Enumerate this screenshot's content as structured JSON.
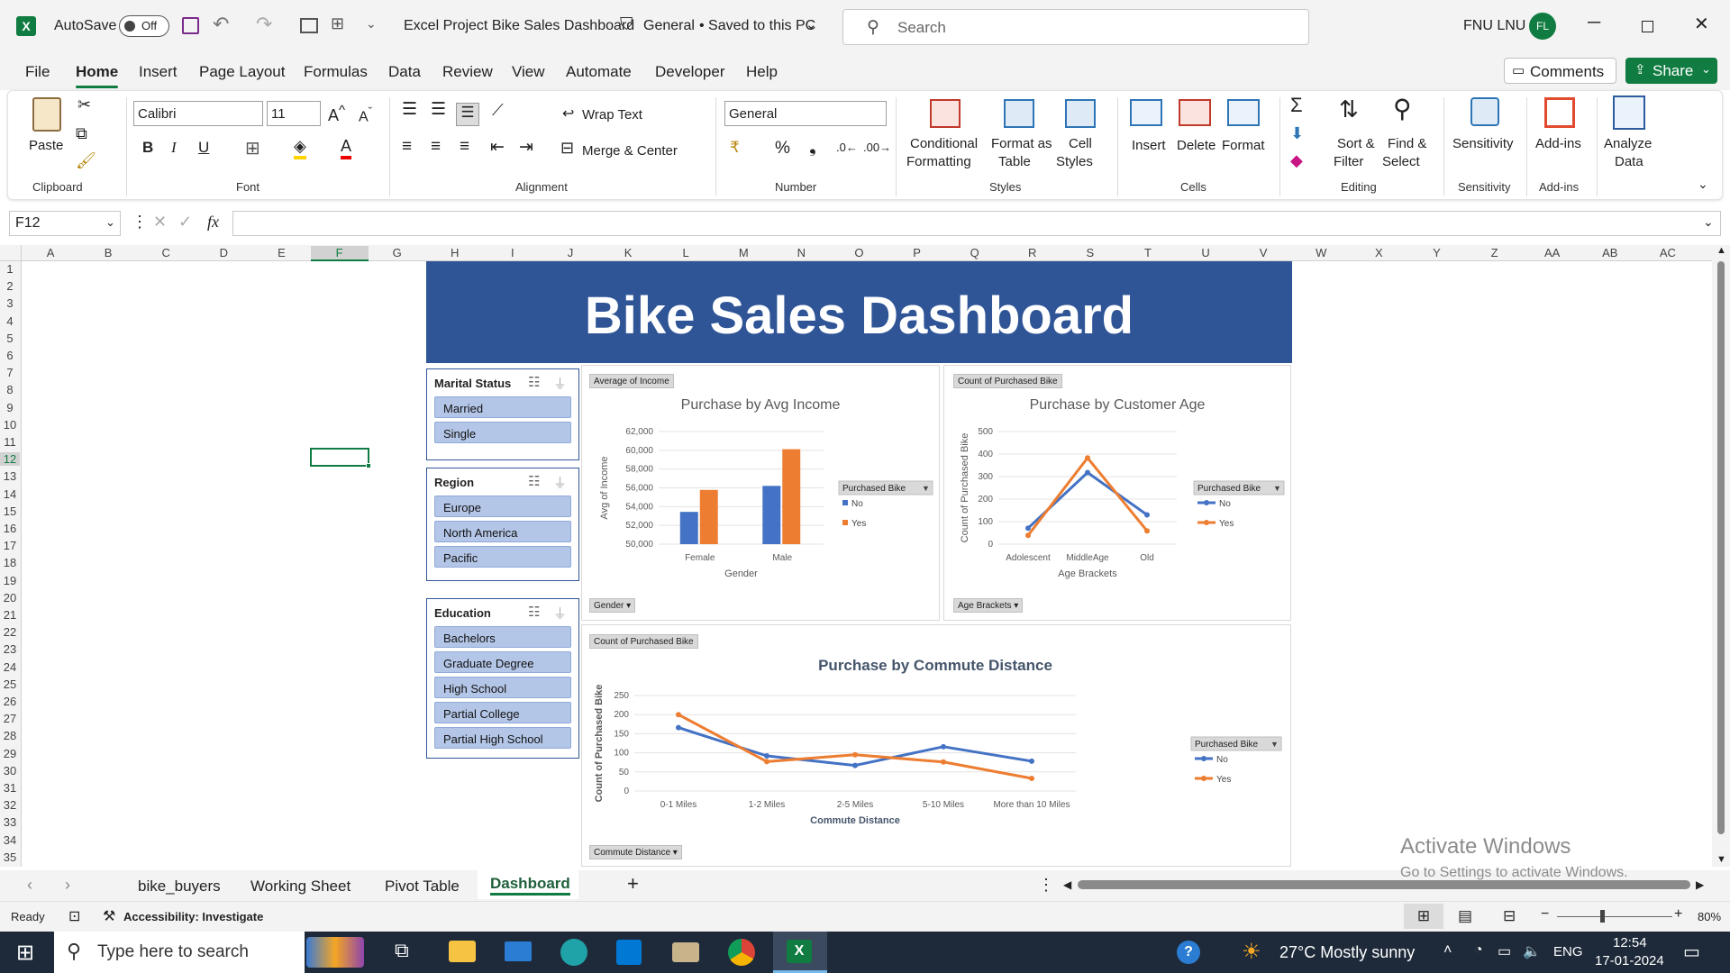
{
  "titlebar": {
    "autosave_label": "AutoSave",
    "autosave_state": "Off",
    "doc_title": "Excel Project Bike Sales Dashboard",
    "sensitivity": "General",
    "save_state": "• Saved to this PC",
    "search_placeholder": "Search",
    "user_name": "FNU LNU",
    "user_initials": "FL"
  },
  "menu": {
    "items": [
      "File",
      "Home",
      "Insert",
      "Page Layout",
      "Formulas",
      "Data",
      "Review",
      "View",
      "Automate",
      "Developer",
      "Help"
    ],
    "comments_label": "Comments",
    "share_label": "Share"
  },
  "ribbon": {
    "clipboard": {
      "paste": "Paste",
      "group": "Clipboard"
    },
    "font": {
      "name": "Calibri",
      "size": "11",
      "group": "Font"
    },
    "alignment": {
      "wrap": "Wrap Text",
      "merge": "Merge & Center",
      "group": "Alignment"
    },
    "number": {
      "format": "General",
      "group": "Number"
    },
    "styles": {
      "conditional_1": "Conditional",
      "conditional_2": "Formatting",
      "format_table_1": "Format as",
      "format_table_2": "Table",
      "cell_styles_1": "Cell",
      "cell_styles_2": "Styles",
      "group": "Styles"
    },
    "cells": {
      "insert": "Insert",
      "delete": "Delete",
      "format": "Format",
      "group": "Cells"
    },
    "editing": {
      "sort_1": "Sort &",
      "sort_2": "Filter",
      "find_1": "Find &",
      "find_2": "Select",
      "group": "Editing"
    },
    "sensitivity": {
      "label": "Sensitivity",
      "group": "Sensitivity"
    },
    "addins": {
      "label": "Add-ins",
      "group": "Add-ins"
    },
    "analyze": {
      "label_1": "Analyze",
      "label_2": "Data"
    }
  },
  "formula_bar": {
    "name_box": "F12",
    "fx": "fx",
    "value": ""
  },
  "columns": [
    "A",
    "B",
    "C",
    "D",
    "E",
    "F",
    "G",
    "H",
    "I",
    "J",
    "K",
    "L",
    "M",
    "N",
    "O",
    "P",
    "Q",
    "R",
    "S",
    "T",
    "U",
    "V",
    "W",
    "X",
    "Y",
    "Z",
    "AA",
    "AB",
    "AC"
  ],
  "rows": [
    "1",
    "2",
    "3",
    "4",
    "5",
    "6",
    "7",
    "8",
    "9",
    "10",
    "11",
    "12",
    "13",
    "14",
    "15",
    "16",
    "17",
    "18",
    "19",
    "20",
    "21",
    "22",
    "23",
    "24",
    "25",
    "26",
    "27",
    "28",
    "29",
    "30",
    "31",
    "32",
    "33",
    "34",
    "35"
  ],
  "dashboard": {
    "title": "Bike Sales Dashboard",
    "slicers": [
      {
        "title": "Marital Status",
        "items": [
          "Married",
          "Single"
        ]
      },
      {
        "title": "Region",
        "items": [
          "Europe",
          "North America",
          "Pacific"
        ]
      },
      {
        "title": "Education",
        "items": [
          "Bachelors",
          "Graduate Degree",
          "High School",
          "Partial College",
          "Partial High School"
        ]
      }
    ]
  },
  "chart_data": [
    {
      "type": "bar",
      "title": "Purchase by Avg Income",
      "field_button": "Average of Income",
      "axis_field_button": "Gender",
      "legend_title": "Purchased Bike",
      "xlabel": "Gender",
      "ylabel": "Avg of Income",
      "ylim": [
        50000,
        62000
      ],
      "yticks": [
        "50,000",
        "52,000",
        "54,000",
        "56,000",
        "58,000",
        "60,000",
        "62,000"
      ],
      "categories": [
        "Female",
        "Male"
      ],
      "series": [
        {
          "name": "No",
          "color": "#4472c4",
          "values": [
            53440,
            56210
          ]
        },
        {
          "name": "Yes",
          "color": "#ed7d31",
          "values": [
            55780,
            60120
          ]
        }
      ],
      "legend_position": "right"
    },
    {
      "type": "line",
      "title": "Purchase by Customer Age",
      "field_button": "Count of Purchased Bike",
      "axis_field_button": "Age Brackets",
      "legend_title": "Purchased Bike",
      "xlabel": "Age Brackets",
      "ylabel": "Count of Purchased Bike",
      "ylim": [
        0,
        500
      ],
      "yticks": [
        "0",
        "100",
        "200",
        "300",
        "400",
        "500"
      ],
      "categories": [
        "Adolescent",
        "MiddleAge",
        "Old"
      ],
      "series": [
        {
          "name": "No",
          "color": "#4472c4",
          "values": [
            71,
            318,
            130
          ]
        },
        {
          "name": "Yes",
          "color": "#ed7d31",
          "values": [
            39,
            383,
            59
          ]
        }
      ],
      "legend_position": "right"
    },
    {
      "type": "line",
      "title": "Purchase by Commute Distance",
      "field_button": "Count of Purchased Bike",
      "axis_field_button": "Commute Distance",
      "legend_title": "Purchased Bike",
      "xlabel": "Commute Distance",
      "ylabel": "Count of Purchased Bike",
      "ylim": [
        0,
        250
      ],
      "yticks": [
        "0",
        "50",
        "100",
        "150",
        "200",
        "250"
      ],
      "categories": [
        "0-1 Miles",
        "1-2 Miles",
        "2-5 Miles",
        "5-10 Miles",
        "More than 10 Miles"
      ],
      "series": [
        {
          "name": "No",
          "color": "#4472c4",
          "values": [
            166,
            92,
            67,
            116,
            78
          ]
        },
        {
          "name": "Yes",
          "color": "#ed7d31",
          "values": [
            200,
            77,
            95,
            76,
            33
          ]
        }
      ],
      "legend_position": "right"
    }
  ],
  "sheet_tabs": [
    "bike_buyers",
    "Working Sheet",
    "Pivot Table",
    "Dashboard"
  ],
  "active_tab": "Dashboard",
  "status": {
    "ready": "Ready",
    "accessibility": "Accessibility: Investigate",
    "zoom": "80%"
  },
  "watermark": {
    "line1": "Activate Windows",
    "line2": "Go to Settings to activate Windows."
  },
  "taskbar": {
    "search_placeholder": "Type here to search",
    "weather": "27°C  Mostly sunny",
    "lang": "ENG",
    "time": "12:54",
    "date": "17-01-2024"
  }
}
